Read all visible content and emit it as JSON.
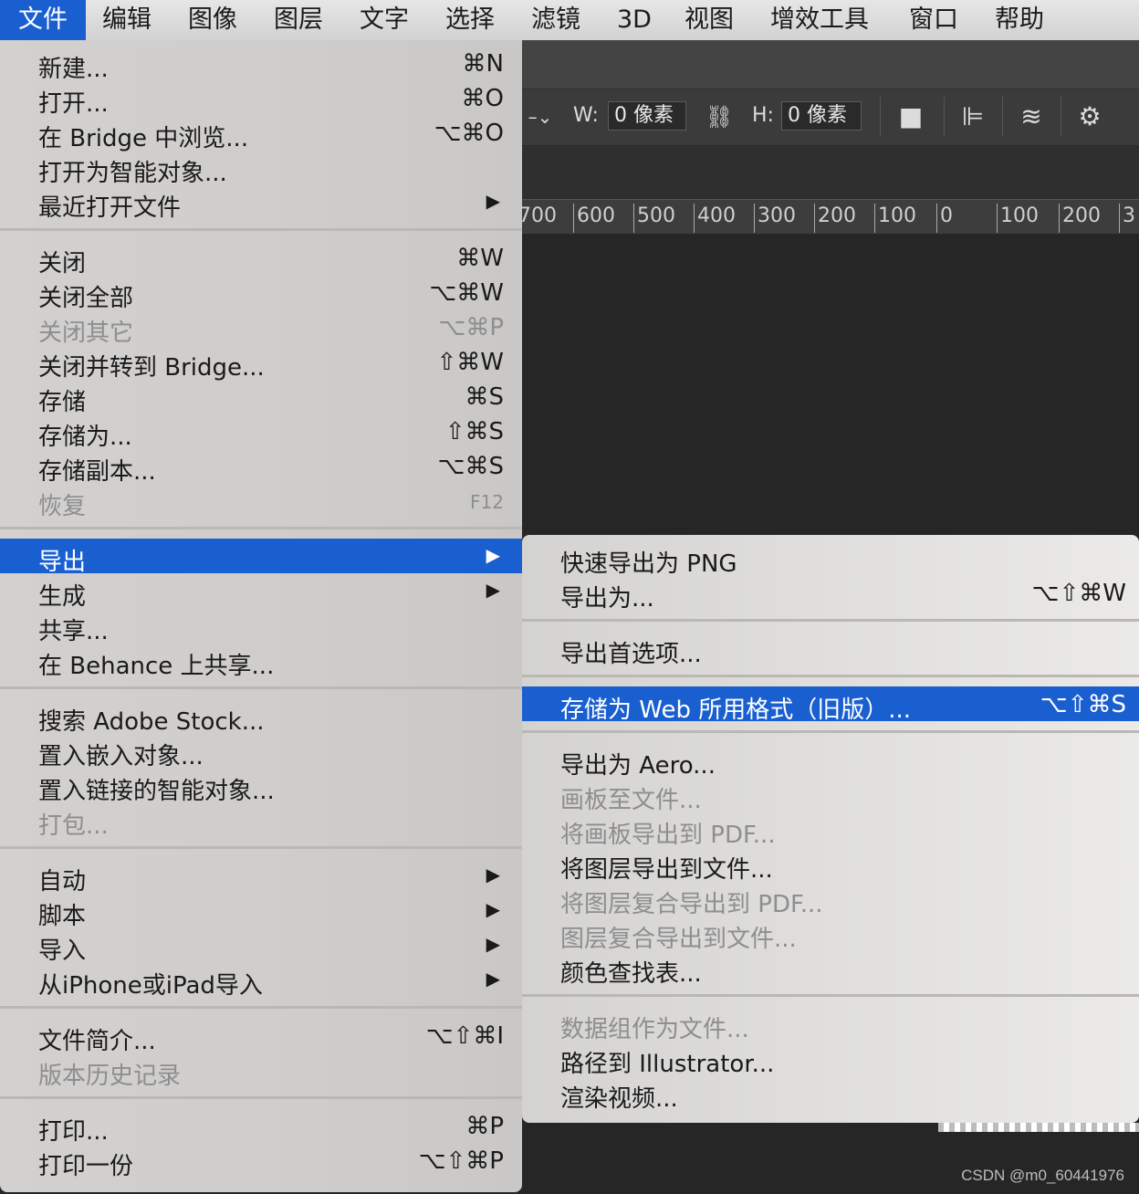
{
  "menubar": {
    "items": [
      "文件",
      "编辑",
      "图像",
      "图层",
      "文字",
      "选择",
      "滤镜",
      "3D",
      "视图",
      "增效工具",
      "窗口",
      "帮助"
    ]
  },
  "options": {
    "w_label": "W:",
    "w_value": "0 像素",
    "h_label": "H:",
    "h_value": "0 像素"
  },
  "ruler": {
    "ticks": [
      "700",
      "600",
      "500",
      "400",
      "300",
      "200",
      "100",
      "0",
      "100",
      "200",
      "3"
    ]
  },
  "file_menu": {
    "groups": [
      [
        {
          "label": "新建...",
          "shortcut": "⌘N"
        },
        {
          "label": "打开...",
          "shortcut": "⌘O"
        },
        {
          "label": "在 Bridge 中浏览...",
          "shortcut": "⌥⌘O"
        },
        {
          "label": "打开为智能对象...",
          "shortcut": ""
        },
        {
          "label": "最近打开文件",
          "shortcut": "",
          "submenu": true
        }
      ],
      [
        {
          "label": "关闭",
          "shortcut": "⌘W"
        },
        {
          "label": "关闭全部",
          "shortcut": "⌥⌘W"
        },
        {
          "label": "关闭其它",
          "shortcut": "⌥⌘P",
          "disabled": true
        },
        {
          "label": "关闭并转到 Bridge...",
          "shortcut": "⇧⌘W"
        },
        {
          "label": "存储",
          "shortcut": "⌘S"
        },
        {
          "label": "存储为...",
          "shortcut": "⇧⌘S"
        },
        {
          "label": "存储副本...",
          "shortcut": "⌥⌘S"
        },
        {
          "label": "恢复",
          "shortcut": "F12",
          "disabled": true
        }
      ],
      [
        {
          "label": "导出",
          "shortcut": "",
          "submenu": true,
          "highlighted": true
        },
        {
          "label": "生成",
          "shortcut": "",
          "submenu": true
        },
        {
          "label": "共享...",
          "shortcut": ""
        },
        {
          "label": "在 Behance 上共享...",
          "shortcut": ""
        }
      ],
      [
        {
          "label": "搜索 Adobe Stock...",
          "shortcut": ""
        },
        {
          "label": "置入嵌入对象...",
          "shortcut": ""
        },
        {
          "label": "置入链接的智能对象...",
          "shortcut": ""
        },
        {
          "label": "打包...",
          "shortcut": "",
          "disabled": true
        }
      ],
      [
        {
          "label": "自动",
          "shortcut": "",
          "submenu": true
        },
        {
          "label": "脚本",
          "shortcut": "",
          "submenu": true
        },
        {
          "label": "导入",
          "shortcut": "",
          "submenu": true
        },
        {
          "label": "从iPhone或iPad导入",
          "shortcut": "",
          "submenu": true
        }
      ],
      [
        {
          "label": "文件简介...",
          "shortcut": "⌥⇧⌘I"
        },
        {
          "label": "版本历史记录",
          "shortcut": "",
          "disabled": true
        }
      ],
      [
        {
          "label": "打印...",
          "shortcut": "⌘P"
        },
        {
          "label": "打印一份",
          "shortcut": "⌥⇧⌘P"
        }
      ]
    ]
  },
  "export_menu": {
    "groups": [
      [
        {
          "label": "快速导出为 PNG",
          "shortcut": ""
        },
        {
          "label": "导出为...",
          "shortcut": "⌥⇧⌘W"
        }
      ],
      [
        {
          "label": "导出首选项...",
          "shortcut": ""
        }
      ],
      [
        {
          "label": "存储为 Web 所用格式（旧版）...",
          "shortcut": "⌥⇧⌘S",
          "highlighted": true
        }
      ],
      [
        {
          "label": "导出为 Aero...",
          "shortcut": ""
        },
        {
          "label": "画板至文件...",
          "shortcut": "",
          "disabled": true
        },
        {
          "label": "将画板导出到 PDF...",
          "shortcut": "",
          "disabled": true
        },
        {
          "label": "将图层导出到文件...",
          "shortcut": ""
        },
        {
          "label": "将图层复合导出到 PDF...",
          "shortcut": "",
          "disabled": true
        },
        {
          "label": "图层复合导出到文件...",
          "shortcut": "",
          "disabled": true
        },
        {
          "label": "颜色查找表...",
          "shortcut": ""
        }
      ],
      [
        {
          "label": "数据组作为文件...",
          "shortcut": "",
          "disabled": true
        },
        {
          "label": "路径到 Illustrator...",
          "shortcut": ""
        },
        {
          "label": "渲染视频...",
          "shortcut": ""
        }
      ]
    ]
  },
  "submenu_arrow": "▶",
  "watermark": "CSDN @m0_60441976"
}
